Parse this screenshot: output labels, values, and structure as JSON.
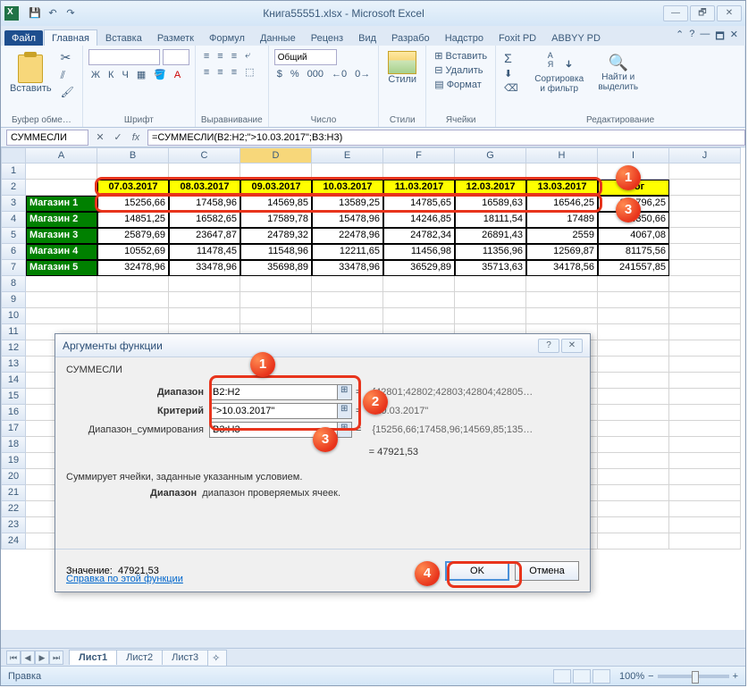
{
  "window": {
    "title": "Книга55551.xlsx - Microsoft Excel",
    "minimize": "—",
    "maximize": "🗖",
    "restore": "🗗",
    "close": "✕"
  },
  "qat": {
    "save": "💾",
    "undo": "↶",
    "redo": "↷"
  },
  "tabs": {
    "file": "Файл",
    "home": "Главная",
    "insert": "Вставка",
    "layout": "Разметк",
    "formulas": "Формул",
    "data": "Данные",
    "review": "Реценз",
    "view": "Вид",
    "dev": "Разрабо",
    "addins": "Надстро",
    "foxit": "Foxit PD",
    "abbyy": "ABBYY PD"
  },
  "ribbon": {
    "paste": "Вставить",
    "clipboard": "Буфер обме…",
    "font": "Шрифт",
    "font_face": "",
    "font_size": "",
    "bold": "Ж",
    "italic": "К",
    "underline": "Ч",
    "align": "Выравнивание",
    "number": "Число",
    "number_format": "Общий",
    "styles": "Стили",
    "styles_btn": "Стили",
    "cells": "Ячейки",
    "insert_c": "Вставить",
    "delete_c": "Удалить",
    "format_c": "Формат",
    "editing": "Редактирование",
    "sort": "Сортировка и фильтр",
    "find": "Найти и выделить"
  },
  "formula_bar": {
    "name": "СУММЕСЛИ",
    "cancel": "✕",
    "enter": "✓",
    "fx": "fx",
    "formula": "=СУММЕСЛИ(B2:H2;\">10.03.2017\";B3:H3)"
  },
  "columns": [
    "A",
    "B",
    "C",
    "D",
    "E",
    "F",
    "G",
    "H",
    "I",
    "J"
  ],
  "rows_visible": 24,
  "table": {
    "dates": [
      "07.03.2017",
      "08.03.2017",
      "09.03.2017",
      "10.03.2017",
      "11.03.2017",
      "12.03.2017",
      "13.03.2017"
    ],
    "itog_header": "Итог",
    "rows": [
      {
        "label": "Магазин 1",
        "vals": [
          "15256,66",
          "17458,96",
          "14569,85",
          "13589,25",
          "14785,65",
          "16589,63",
          "16546,25"
        ],
        "itog": "108796,25"
      },
      {
        "label": "Магазин 2",
        "vals": [
          "14851,25",
          "16582,65",
          "17589,78",
          "15478,96",
          "14246,85",
          "18111,54",
          "17489"
        ],
        "itog": "4350,66"
      },
      {
        "label": "Магазин 3",
        "vals": [
          "25879,69",
          "23647,87",
          "24789,32",
          "22478,96",
          "24782,34",
          "26891,43",
          "2559"
        ],
        "itog": "4067,08"
      },
      {
        "label": "Магазин 4",
        "vals": [
          "10552,69",
          "11478,45",
          "11548,96",
          "12211,65",
          "11456,98",
          "11356,96",
          "12569,87"
        ],
        "itog": "81175,56"
      },
      {
        "label": "Магазин 5",
        "vals": [
          "32478,96",
          "33478,96",
          "35698,89",
          "33478,96",
          "36529,89",
          "35713,63",
          "34178,56"
        ],
        "itog": "241557,85"
      }
    ]
  },
  "dialog": {
    "title": "Аргументы функции",
    "func": "СУММЕСЛИ",
    "labels": {
      "range": "Диапазон",
      "criteria": "Критерий",
      "sumrange": "Диапазон_суммирования"
    },
    "values": {
      "range": "B2:H2",
      "criteria": "\">10.03.2017\"",
      "sumrange": "B3:H3"
    },
    "evals": {
      "range": "{42801;42802;42803;42804;42805…",
      "criteria": "\"10.03.2017\"",
      "sumrange": "{15256,66;17458,96;14569,85;135…"
    },
    "result_preview": "= 47921,53",
    "desc": "Суммирует ячейки, заданные указанным условием.",
    "desc2_label": "Диапазон",
    "desc2_text": "диапазон проверяемых ячеек.",
    "result_label": "Значение:",
    "result_value": "47921,53",
    "help": "Справка по этой функции",
    "ok": "OK",
    "cancel": "Отмена"
  },
  "sheet_tabs": {
    "s1": "Лист1",
    "s2": "Лист2",
    "s3": "Лист3"
  },
  "status": {
    "mode": "Правка",
    "zoom": "100%",
    "minus": "−",
    "plus": "+"
  },
  "badges": {
    "b1": "1",
    "b2": "2",
    "b3": "3",
    "b4": "4"
  }
}
